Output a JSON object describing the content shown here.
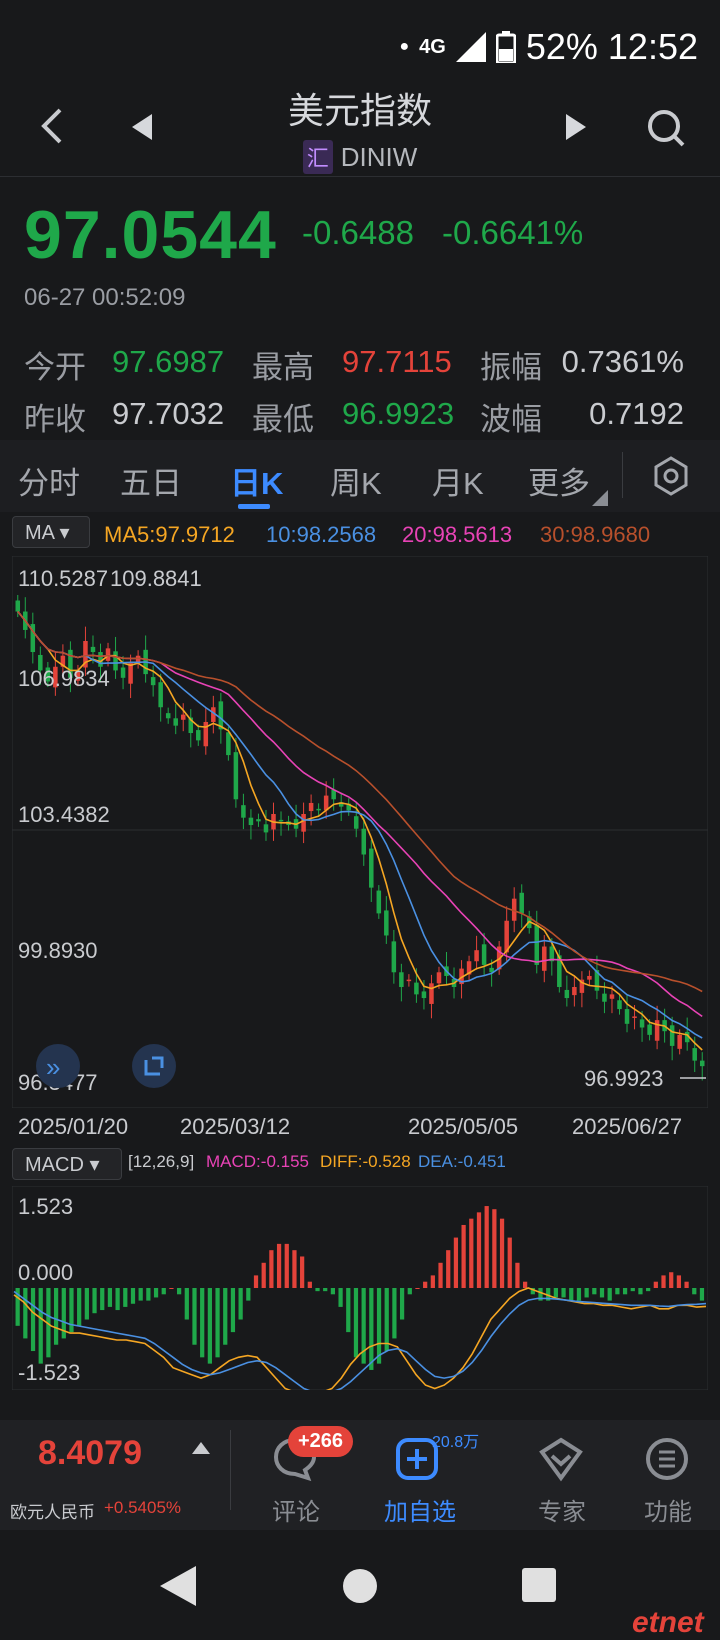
{
  "status": {
    "network": "4G",
    "battery": "52%",
    "time": "12:52"
  },
  "header": {
    "title": "美元指数",
    "tag": "汇",
    "code": "DINIW"
  },
  "quote": {
    "price": "97.0544",
    "change": "-0.6488",
    "change_pct": "-0.6641%",
    "datetime": "06-27 00:52:09"
  },
  "stats": {
    "open_label": "今开",
    "open": "97.6987",
    "high_label": "最高",
    "high": "97.7115",
    "amp_label": "振幅",
    "amp": "0.7361%",
    "prev_label": "昨收",
    "prev": "97.7032",
    "low_label": "最低",
    "low": "96.9923",
    "wave_label": "波幅",
    "wave": "0.7192"
  },
  "tabs": [
    "分时",
    "五日",
    "日K",
    "周K",
    "月K",
    "更多"
  ],
  "active_tab": "日K",
  "ma": {
    "selector": "MA",
    "ma5": "MA5:97.9712",
    "ma10": "10:98.2568",
    "ma20": "20:98.5613",
    "ma30": "30:98.9680"
  },
  "macd": {
    "selector": "MACD",
    "params": "[12,26,9]",
    "macd": "MACD:-0.155",
    "diff": "DIFF:-0.528",
    "dea": "DEA:-0.451"
  },
  "colors": {
    "up": "#e4433a",
    "down": "#1fa84a",
    "ma5": "#f5a623",
    "ma10": "#4a90e2",
    "ma20": "#e843b6",
    "ma30": "#b8502c",
    "accent": "#3d8bff"
  },
  "chart_data": [
    {
      "type": "candlestick",
      "y_tick_labels": [
        "110.5287",
        "106.9834",
        "103.4382",
        "99.8930",
        "96.3477"
      ],
      "ylim": [
        96.3477,
        110.5287
      ],
      "max_label": "109.8841",
      "min_label": "96.9923",
      "x_tick_labels": [
        "2025/01/20",
        "2025/03/12",
        "2025/05/05",
        "2025/06/27"
      ],
      "close_series": [
        109.4,
        108.9,
        108.3,
        107.8,
        107.5,
        107.9,
        108.2,
        107.6,
        107.8,
        108.6,
        108.3,
        107.9,
        108.4,
        107.8,
        107.6,
        108.0,
        108.2,
        107.7,
        107.4,
        106.8,
        106.5,
        106.3,
        106.6,
        106.1,
        105.9,
        106.4,
        106.8,
        106.2,
        105.5,
        104.3,
        103.8,
        103.6,
        103.7,
        103.4,
        103.9,
        103.7,
        103.6,
        103.5,
        103.9,
        104.2,
        104.0,
        104.4,
        104.3,
        104.1,
        104.0,
        103.5,
        102.8,
        101.9,
        101.2,
        100.6,
        99.6,
        99.2,
        99.4,
        99.0,
        98.9,
        99.3,
        99.6,
        99.5,
        99.2,
        99.7,
        99.9,
        100.2,
        99.8,
        99.6,
        100.3,
        101.0,
        101.6,
        101.2,
        100.8,
        99.8,
        100.3,
        99.9,
        99.2,
        98.9,
        99.2,
        99.4,
        99.5,
        99.1,
        98.8,
        99.0,
        98.6,
        98.2,
        98.4,
        98.1,
        97.9,
        98.3,
        98.0,
        97.6,
        97.9,
        97.7,
        97.2,
        97.05
      ],
      "min_value": 96.9923,
      "max_value": 109.8841
    },
    {
      "type": "bar",
      "title": "MACD",
      "y_tick_labels": [
        "1.523",
        "0.000",
        "-1.523"
      ],
      "ylim": [
        -1.523,
        1.523
      ],
      "macd_bars": [
        -0.6,
        -0.8,
        -1.0,
        -1.2,
        -1.1,
        -0.9,
        -0.8,
        -0.7,
        -0.6,
        -0.5,
        -0.4,
        -0.35,
        -0.3,
        -0.35,
        -0.3,
        -0.25,
        -0.2,
        -0.2,
        -0.15,
        -0.1,
        0.0,
        -0.1,
        -0.5,
        -0.9,
        -1.1,
        -1.2,
        -1.1,
        -0.9,
        -0.7,
        -0.5,
        -0.2,
        0.2,
        0.4,
        0.6,
        0.7,
        0.7,
        0.6,
        0.5,
        0.1,
        -0.05,
        -0.05,
        -0.1,
        -0.3,
        -0.7,
        -1.1,
        -1.2,
        -1.3,
        -1.2,
        -1.0,
        -0.8,
        -0.5,
        -0.1,
        0.0,
        0.1,
        0.2,
        0.4,
        0.6,
        0.8,
        1.0,
        1.1,
        1.2,
        1.3,
        1.25,
        1.1,
        0.8,
        0.4,
        0.1,
        -0.1,
        -0.2,
        -0.2,
        -0.15,
        -0.15,
        -0.2,
        -0.2,
        -0.15,
        -0.1,
        -0.15,
        -0.2,
        -0.1,
        -0.1,
        -0.05,
        -0.1,
        -0.05,
        0.1,
        0.2,
        0.25,
        0.2,
        0.1,
        -0.1,
        -0.2
      ],
      "diff": [
        -0.2,
        -0.4,
        -0.7,
        -0.9,
        -1.1,
        -1.2,
        -1.3,
        -1.3,
        -1.35,
        -1.4,
        -1.45,
        -1.5,
        -1.5,
        -1.55,
        -1.6,
        -1.8,
        -2.0,
        -2.3,
        -2.4,
        -2.5,
        -2.6,
        -2.5,
        -2.3,
        -2.1,
        -2.0,
        -1.95,
        -2.0,
        -2.3,
        -2.6,
        -2.9,
        -3.0,
        -3.1,
        -3.05,
        -3.0,
        -2.9,
        -2.6,
        -2.2,
        -1.9,
        -1.7,
        -1.6,
        -1.6,
        -1.7,
        -2.1,
        -2.5,
        -2.8,
        -2.9,
        -2.8,
        -2.6,
        -2.3,
        -1.9,
        -1.4,
        -0.9,
        -0.6,
        -0.3,
        -0.1,
        0.0,
        -0.1,
        -0.2,
        -0.3,
        -0.35,
        -0.4,
        -0.45,
        -0.45,
        -0.5,
        -0.5,
        -0.55,
        -0.6,
        -0.55,
        -0.5,
        -0.6,
        -0.6,
        -0.5,
        -0.5,
        -0.55,
        -0.53
      ],
      "dea": [
        -0.1,
        -0.3,
        -0.5,
        -0.7,
        -0.85,
        -0.95,
        -1.05,
        -1.1,
        -1.15,
        -1.2,
        -1.25,
        -1.3,
        -1.35,
        -1.4,
        -1.45,
        -1.6,
        -1.8,
        -2.0,
        -2.2,
        -2.35,
        -2.45,
        -2.5,
        -2.45,
        -2.35,
        -2.25,
        -2.15,
        -2.1,
        -2.15,
        -2.3,
        -2.5,
        -2.7,
        -2.9,
        -3.0,
        -3.05,
        -3.0,
        -2.9,
        -2.7,
        -2.45,
        -2.2,
        -1.95,
        -1.8,
        -1.75,
        -1.85,
        -2.1,
        -2.35,
        -2.55,
        -2.6,
        -2.55,
        -2.4,
        -2.15,
        -1.8,
        -1.4,
        -1.05,
        -0.75,
        -0.5,
        -0.35,
        -0.3,
        -0.3,
        -0.32,
        -0.35,
        -0.38,
        -0.4,
        -0.42,
        -0.44,
        -0.46,
        -0.48,
        -0.5,
        -0.5,
        -0.5,
        -0.52,
        -0.53,
        -0.5,
        -0.48,
        -0.47,
        -0.45
      ]
    }
  ],
  "bottom": {
    "related_price": "8.4079",
    "related_name": "欧元人民币",
    "related_change": "+0.5405%",
    "comment_badge": "+266",
    "comment_label": "评论",
    "watch_count": "20.8万",
    "watch_label": "加自选",
    "expert_label": "专家",
    "func_label": "功能"
  },
  "watermark": "etnet"
}
